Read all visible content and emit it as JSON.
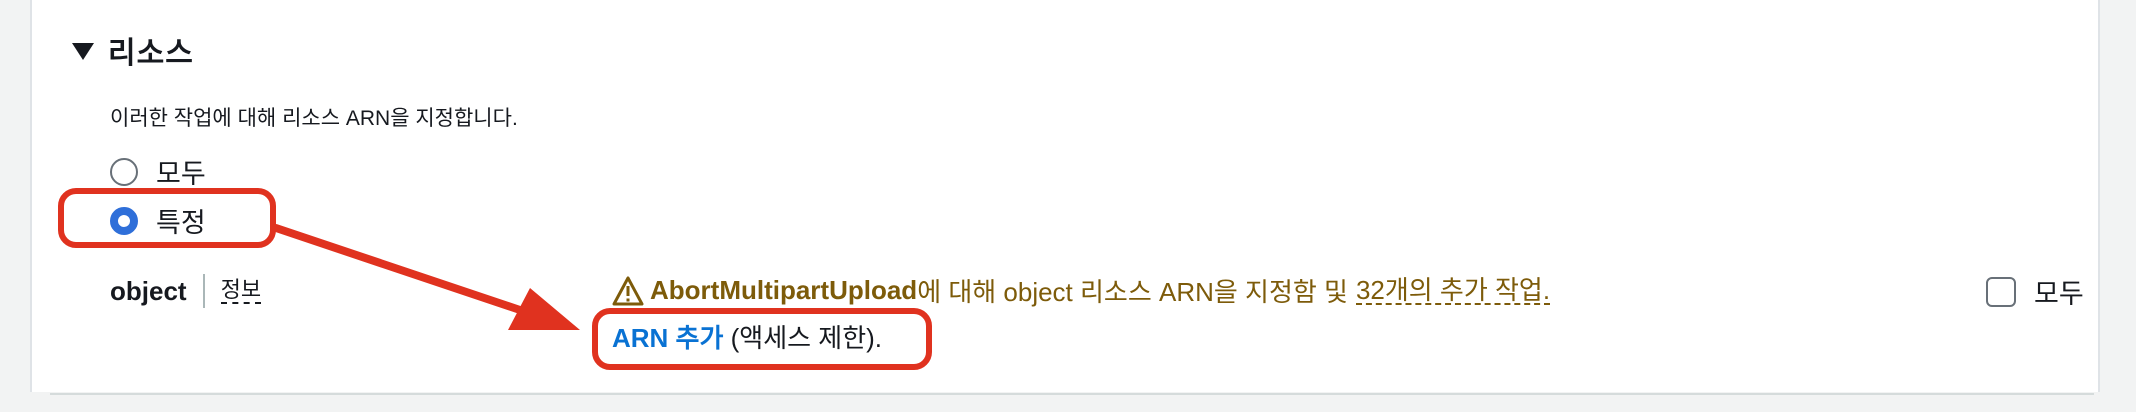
{
  "section": {
    "title": "리소스",
    "description": "이러한 작업에 대해 리소스 ARN을 지정합니다."
  },
  "resource_scope": {
    "options": [
      {
        "label": "모두",
        "selected": false
      },
      {
        "label": "특정",
        "selected": true
      }
    ]
  },
  "object_row": {
    "name": "object",
    "info_label": "정보",
    "warning": {
      "action": "AbortMultipartUpload",
      "text": "에 대해 object 리소스 ARN을 지정함 및",
      "link": "32개의 추가 작업."
    },
    "add_arn": {
      "link": "ARN 추가",
      "suffix": " (액세스 제한)."
    },
    "all_checkbox_label": "모두"
  },
  "annotation_color": "#e0321f",
  "icons": {
    "caret": "caret-down-icon",
    "warning": "warning-triangle-icon"
  }
}
